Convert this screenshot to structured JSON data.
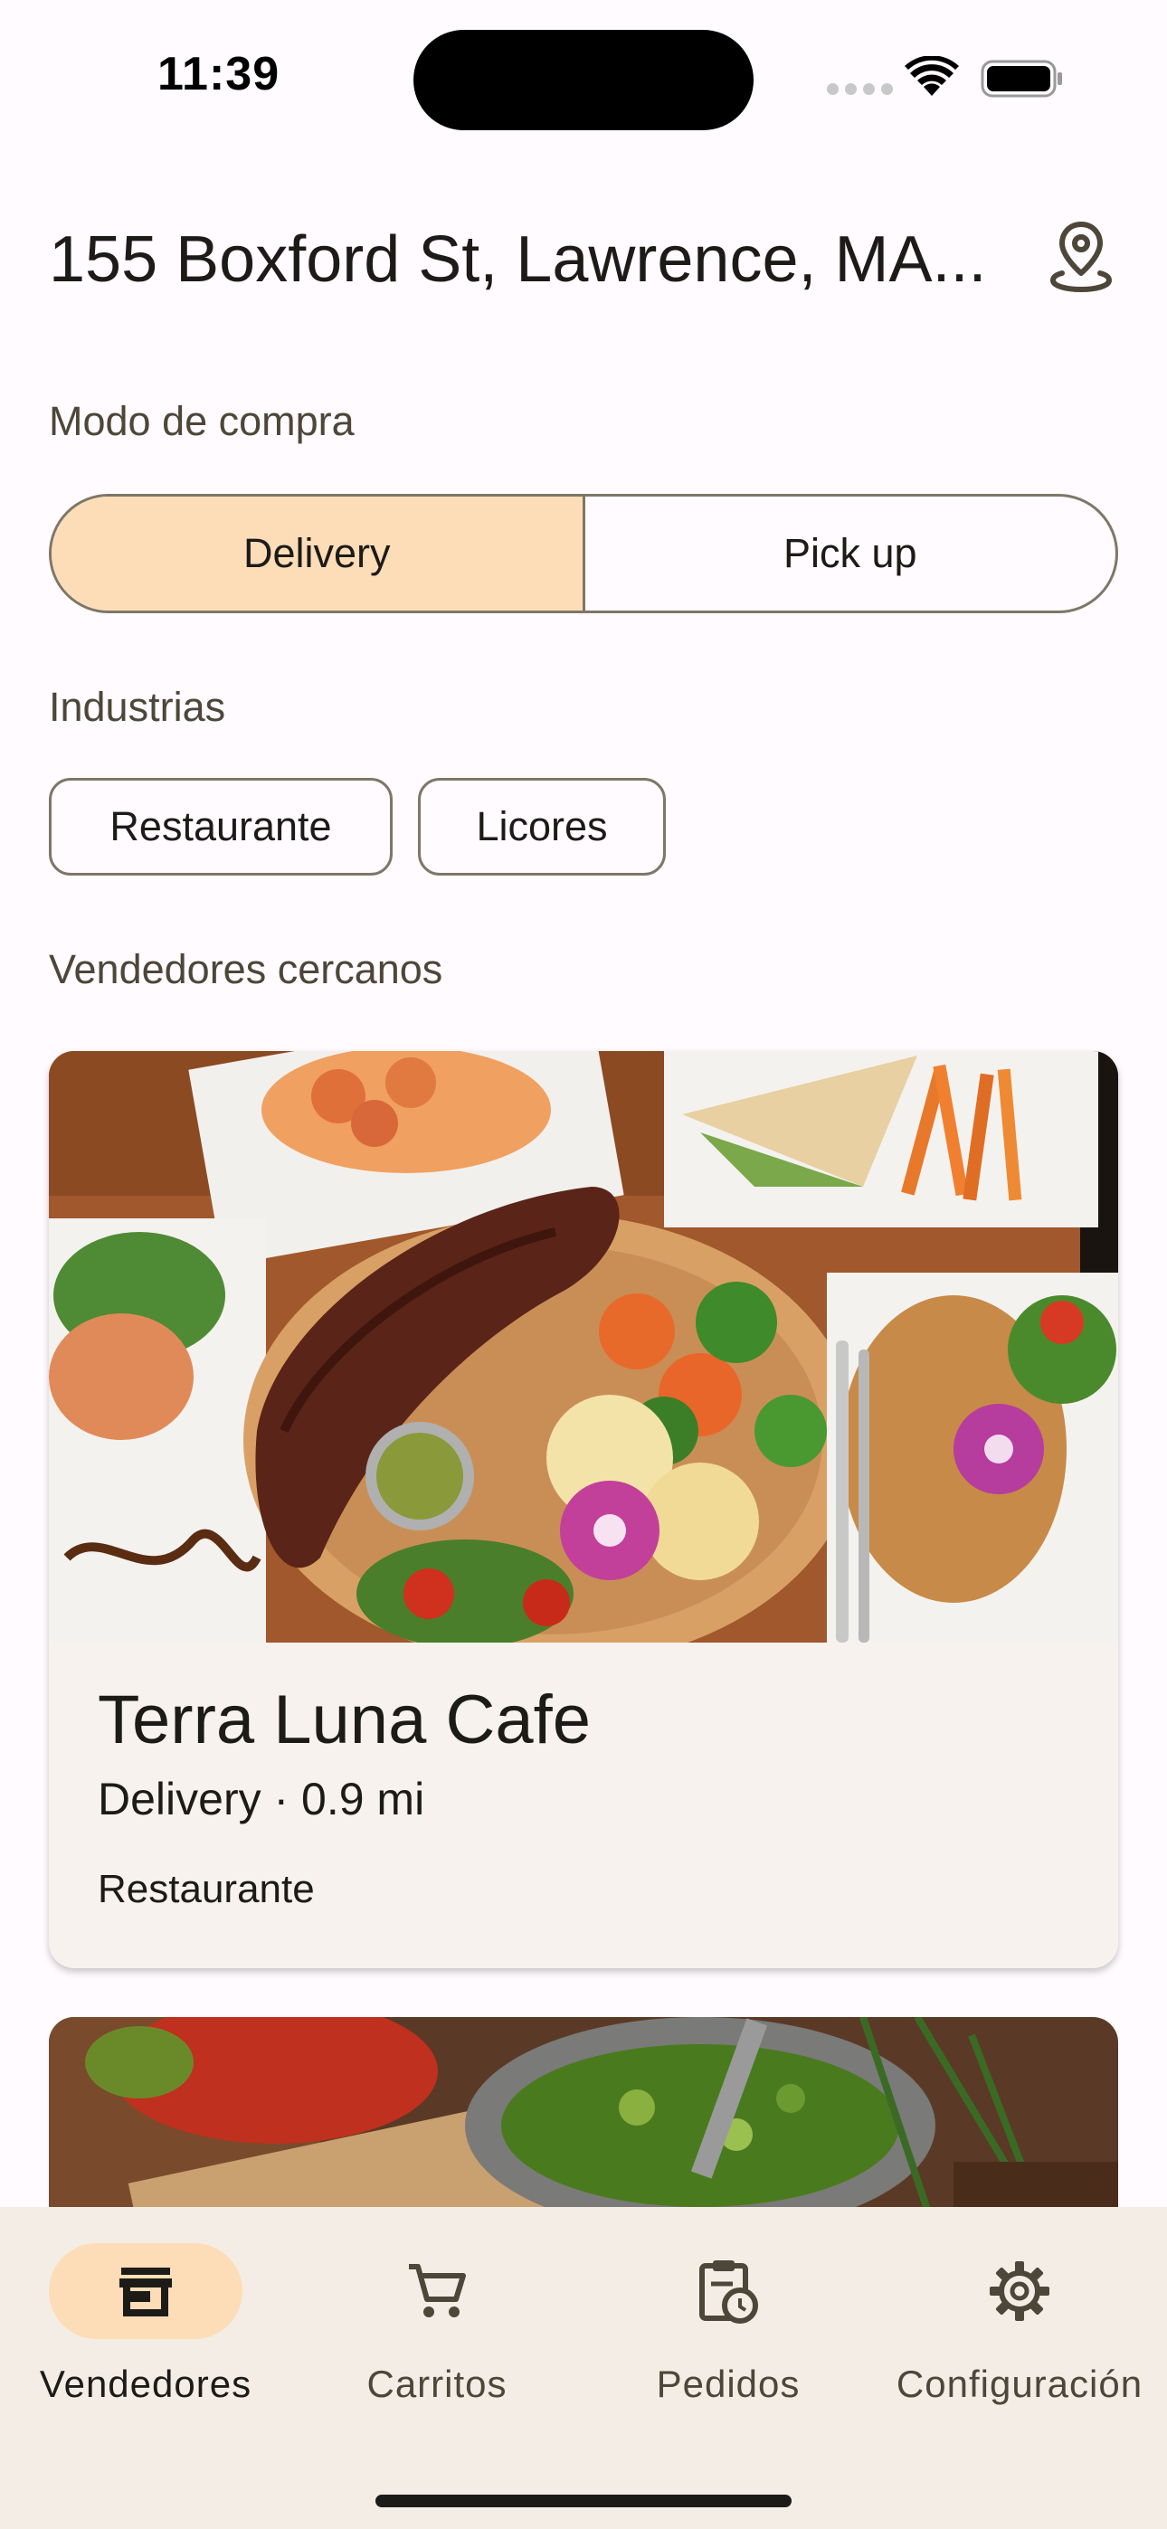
{
  "status_bar": {
    "time": "11:39"
  },
  "header": {
    "address": "155 Boxford St, Lawrence, MA...",
    "location_icon": "location-pin-icon"
  },
  "purchase_mode": {
    "label": "Modo de compra",
    "options": [
      "Delivery",
      "Pick up"
    ],
    "selected": "Delivery"
  },
  "industries": {
    "label": "Industrias",
    "chips": [
      "Restaurante",
      "Licores"
    ]
  },
  "nearby": {
    "label": "Vendedores cercanos",
    "vendors": [
      {
        "name": "Terra Luna Cafe",
        "subtitle": "Delivery · 0.9 mi",
        "industry": "Restaurante"
      }
    ]
  },
  "bottom_nav": {
    "items": [
      {
        "label": "Vendedores",
        "icon": "storefront-icon"
      },
      {
        "label": "Carritos",
        "icon": "cart-icon"
      },
      {
        "label": "Pedidos",
        "icon": "orders-clipboard-icon"
      },
      {
        "label": "Configuración",
        "icon": "gear-icon"
      }
    ],
    "active": "Vendedores"
  },
  "colors": {
    "accent": "#fdddb7",
    "outline": "#7e7667",
    "nav_background": "#f4ede5"
  }
}
